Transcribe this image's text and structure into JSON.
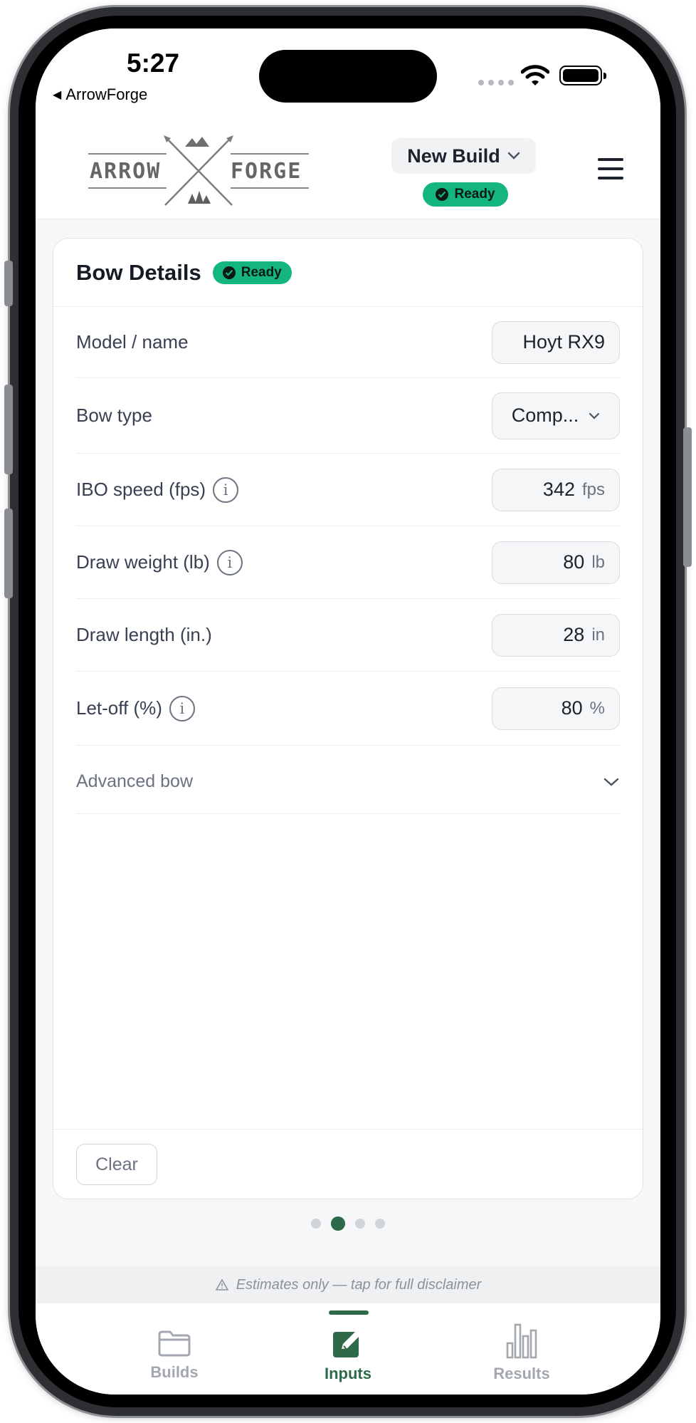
{
  "status_bar": {
    "time": "5:27",
    "back_app": "ArrowForge"
  },
  "header": {
    "logo_text_left": "ARROW",
    "logo_text_right": "FORGE",
    "build_selector_label": "New Build",
    "status_badge": "Ready"
  },
  "card": {
    "title": "Bow Details",
    "badge": "Ready",
    "fields": [
      {
        "label": "Model / name",
        "value": "Hoyt RX9",
        "unit": "",
        "info": false
      },
      {
        "label": "Bow type",
        "value": "Comp...",
        "unit": "",
        "info": false
      },
      {
        "label": "IBO speed (fps)",
        "value": "342",
        "unit": "fps",
        "info": true
      },
      {
        "label": "Draw weight (lb)",
        "value": "80",
        "unit": "lb",
        "info": true
      },
      {
        "label": "Draw length (in.)",
        "value": "28",
        "unit": "in",
        "info": false
      },
      {
        "label": "Let-off (%)",
        "value": "80",
        "unit": "%",
        "info": true
      }
    ],
    "advanced_label": "Advanced bow",
    "clear_button": "Clear"
  },
  "pagination": {
    "total": 4,
    "active_index": 1
  },
  "disclaimer": "Estimates only — tap for full disclaimer",
  "tabs": [
    {
      "label": "Builds",
      "icon": "folder-icon"
    },
    {
      "label": "Inputs",
      "icon": "edit-icon",
      "active": true
    },
    {
      "label": "Results",
      "icon": "bar-chart-icon"
    }
  ],
  "colors": {
    "accent_green": "#2c6a4a",
    "ready_badge": "#15b57e"
  }
}
